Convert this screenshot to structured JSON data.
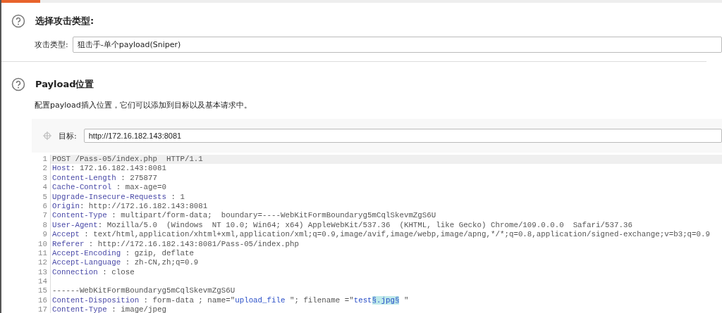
{
  "attack_type_section": {
    "title": "选择攻击类型:",
    "field_label": "攻击类型:",
    "field_value": "狙击手-单个payload(Sniper)"
  },
  "payload_positions_section": {
    "title": "Payload位置",
    "description": "配置payload插入位置，它们可以添加到目标以及基本请求中。",
    "target_label": "目标:",
    "target_value": "http://172.16.182.143:8081"
  },
  "request_editor": {
    "lines": [
      {
        "number": "1",
        "selected": true,
        "segments": [
          {
            "kind": "plain",
            "text": "POST /Pass-05/index.php  HTTP/1.1"
          }
        ]
      },
      {
        "number": "2",
        "selected": false,
        "segments": [
          {
            "kind": "key",
            "text": "Host"
          },
          {
            "kind": "plain",
            "text": ": 172.16.182.143:8081"
          }
        ]
      },
      {
        "number": "3",
        "selected": false,
        "segments": [
          {
            "kind": "key",
            "text": "Content-Length"
          },
          {
            "kind": "plain",
            "text": " : 275877"
          }
        ]
      },
      {
        "number": "4",
        "selected": false,
        "segments": [
          {
            "kind": "key",
            "text": "Cache-Control"
          },
          {
            "kind": "plain",
            "text": " : max-age=0"
          }
        ]
      },
      {
        "number": "5",
        "selected": false,
        "segments": [
          {
            "kind": "key",
            "text": "Upgrade-Insecure-Requests"
          },
          {
            "kind": "plain",
            "text": " : 1"
          }
        ]
      },
      {
        "number": "6",
        "selected": false,
        "segments": [
          {
            "kind": "key",
            "text": "Origin"
          },
          {
            "kind": "plain",
            "text": ": http://172.16.182.143:8081"
          }
        ]
      },
      {
        "number": "7",
        "selected": false,
        "segments": [
          {
            "kind": "key",
            "text": "Content-Type"
          },
          {
            "kind": "plain",
            "text": " : multipart/form-data;  boundary=----WebKitFormBoundaryg5mCqlSkevmZgS6U"
          }
        ]
      },
      {
        "number": "8",
        "selected": false,
        "segments": [
          {
            "kind": "key",
            "text": "User-Agent"
          },
          {
            "kind": "plain",
            "text": ": Mozilla/5.0  (Windows  NT 10.0; Win64; x64) AppleWebKit/537.36  (KHTML, like Gecko) Chrome/109.0.0.0  Safari/537.36"
          }
        ]
      },
      {
        "number": "9",
        "selected": false,
        "segments": [
          {
            "kind": "key",
            "text": "Accept"
          },
          {
            "kind": "plain",
            "text": " : text/html,application/xhtml+xml,application/xml;q=0.9,image/avif,image/webp,image/apng,*/*;q=0.8,application/signed-exchange;v=b3;q=0.9"
          }
        ]
      },
      {
        "number": "10",
        "selected": false,
        "segments": [
          {
            "kind": "key",
            "text": "Referer"
          },
          {
            "kind": "plain",
            "text": " : http://172.16.182.143:8081/Pass-05/index.php"
          }
        ]
      },
      {
        "number": "11",
        "selected": false,
        "segments": [
          {
            "kind": "key",
            "text": "Accept-Encoding"
          },
          {
            "kind": "plain",
            "text": " : gzip, deflate"
          }
        ]
      },
      {
        "number": "12",
        "selected": false,
        "segments": [
          {
            "kind": "key",
            "text": "Accept-Language"
          },
          {
            "kind": "plain",
            "text": " : zh-CN,zh;q=0.9"
          }
        ]
      },
      {
        "number": "13",
        "selected": false,
        "segments": [
          {
            "kind": "key",
            "text": "Connection"
          },
          {
            "kind": "plain",
            "text": " : close"
          }
        ]
      },
      {
        "number": "14",
        "selected": false
      },
      {
        "number": "15",
        "selected": false,
        "segments": [
          {
            "kind": "plain",
            "text": "------WebKitFormBoundaryg5mCqlSkevmZgS6U"
          }
        ]
      },
      {
        "number": "16",
        "selected": false,
        "segments": [
          {
            "kind": "key",
            "text": "Content-Disposition"
          },
          {
            "kind": "plain",
            "text": " : form-data ; name=\""
          },
          {
            "kind": "string",
            "text": "upload_file"
          },
          {
            "kind": "plain",
            "text": " \"; filename =\""
          },
          {
            "kind": "string",
            "text": "test"
          },
          {
            "kind": "marker",
            "text": "§.jpg§"
          },
          {
            "kind": "plain",
            "text": " \""
          }
        ]
      },
      {
        "number": "17",
        "selected": false,
        "segments": [
          {
            "kind": "key",
            "text": "Content-Type"
          },
          {
            "kind": "plain",
            "text": " : image/jpeg"
          }
        ]
      }
    ]
  }
}
